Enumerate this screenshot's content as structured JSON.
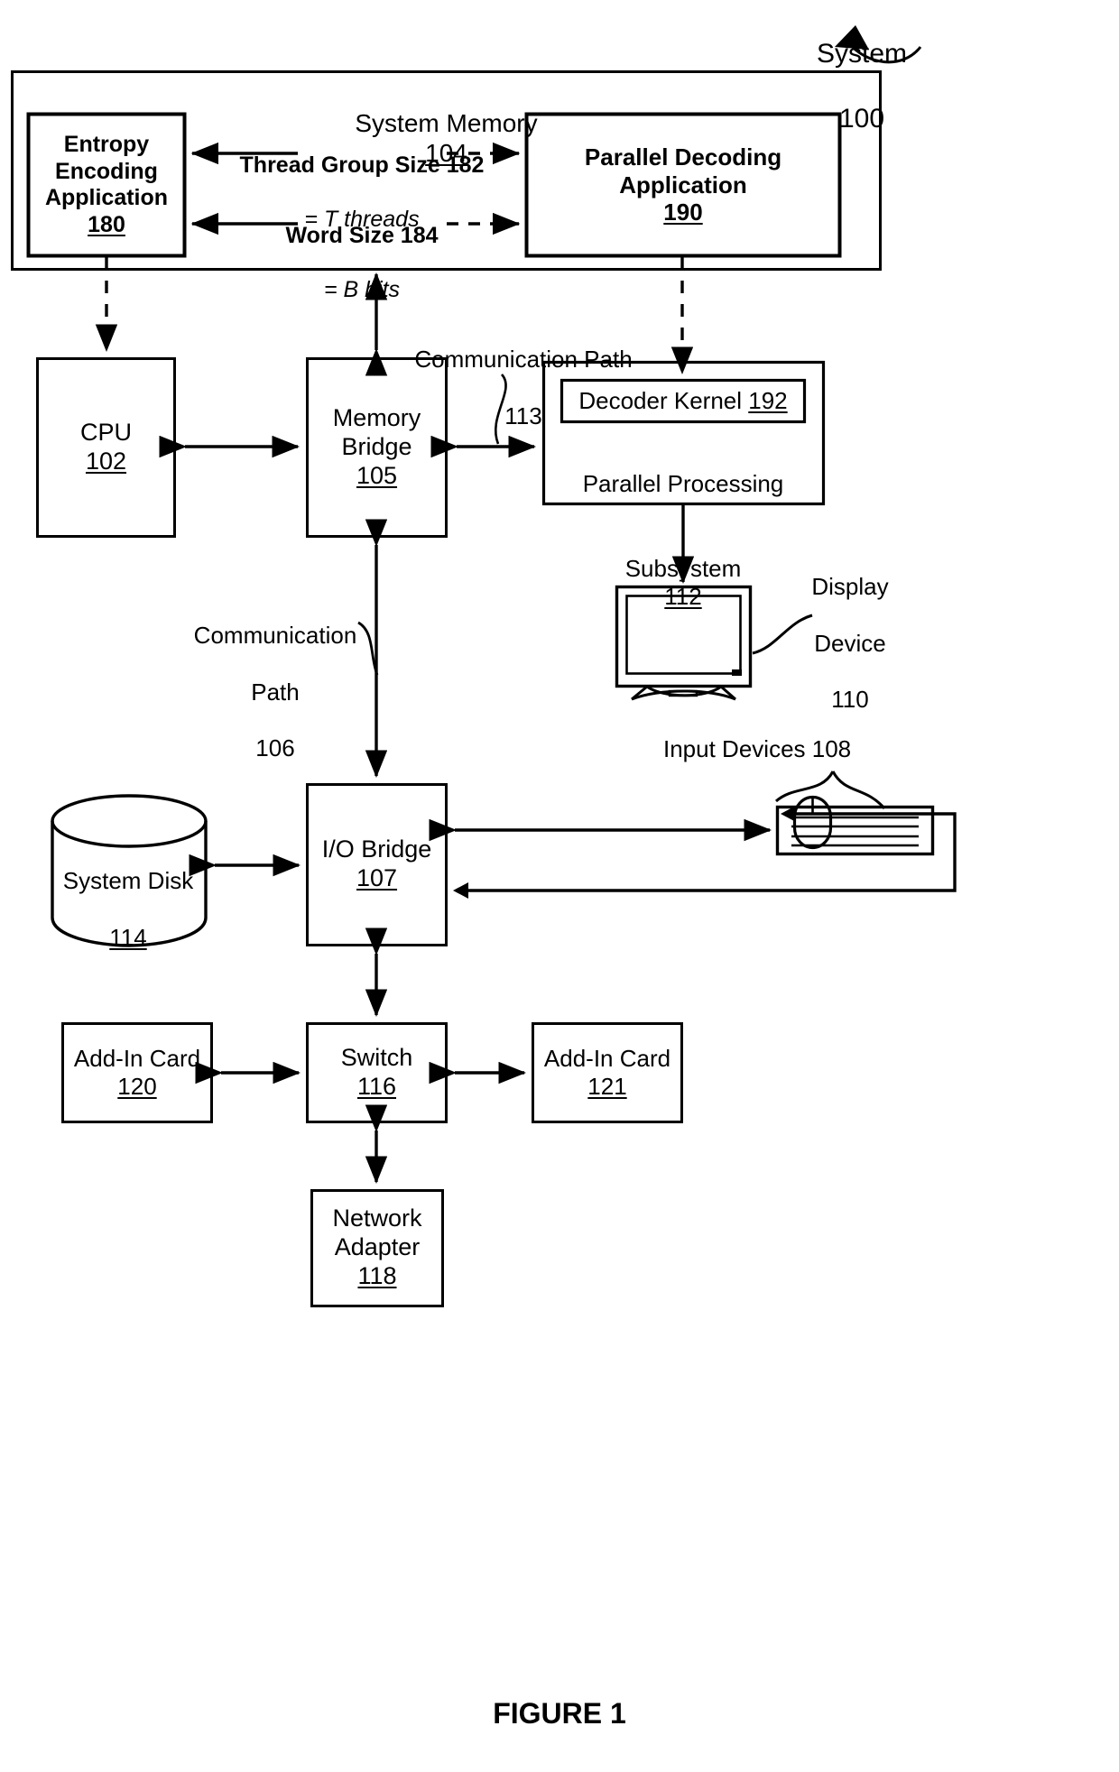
{
  "figure": {
    "caption": "FIGURE 1",
    "system_label": "System",
    "system_ref": "100"
  },
  "system_memory": {
    "title": "System Memory",
    "ref": "104"
  },
  "blocks": {
    "entropy_encoding_application": {
      "line1": "Entropy",
      "line2": "Encoding",
      "line3": "Application",
      "ref": "180"
    },
    "parallel_decoding_application": {
      "line1": "Parallel Decoding",
      "line2": "Application",
      "ref": "190"
    },
    "cpu": {
      "label": "CPU",
      "ref": "102"
    },
    "memory_bridge": {
      "line1": "Memory",
      "line2": "Bridge",
      "ref": "105"
    },
    "decoder_kernel": {
      "label": "Decoder Kernel",
      "ref": "192"
    },
    "parallel_processing_subsystem": {
      "line1": "Parallel Processing",
      "line2": "Subsystem",
      "ref": "112"
    },
    "io_bridge": {
      "label": "I/O Bridge",
      "ref": "107"
    },
    "system_disk": {
      "label": "System Disk",
      "ref": "114"
    },
    "switch": {
      "label": "Switch",
      "ref": "116"
    },
    "add_in_card_120": {
      "label": "Add-In Card",
      "ref": "120"
    },
    "add_in_card_121": {
      "label": "Add-In Card",
      "ref": "121"
    },
    "network_adapter": {
      "line1": "Network",
      "line2": "Adapter",
      "ref": "118"
    },
    "display_device": {
      "line1": "Display",
      "line2": "Device",
      "ref": "110"
    },
    "input_devices": {
      "label": "Input Devices 108"
    }
  },
  "parameters": {
    "thread_group_size": {
      "name": "Thread Group Size 182",
      "value": "= T threads"
    },
    "word_size": {
      "name": "Word Size 184",
      "value": "= B bits"
    }
  },
  "communication_paths": {
    "path_113": {
      "line1": "Communication Path",
      "ref": "113"
    },
    "path_106": {
      "line1": "Communication",
      "line2": "Path",
      "ref": "106"
    }
  },
  "colors": {
    "stroke": "#000000",
    "background": "#ffffff"
  }
}
